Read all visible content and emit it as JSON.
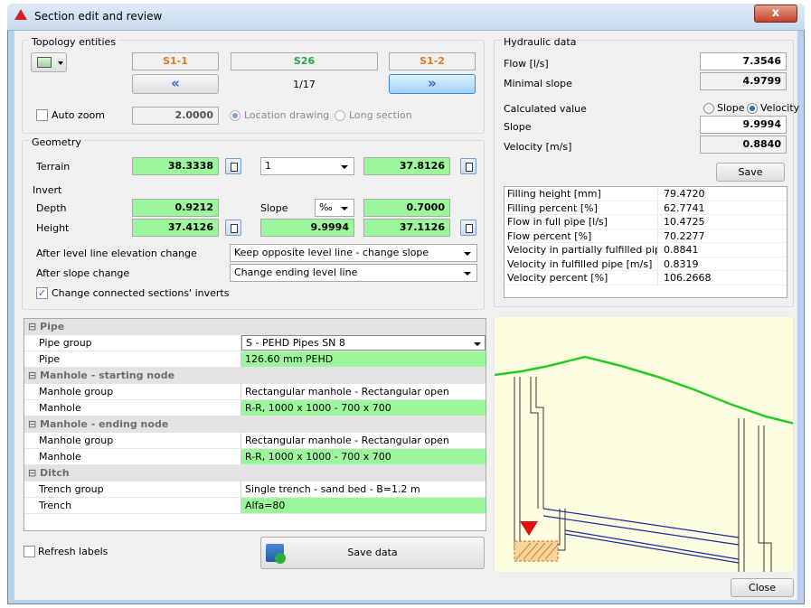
{
  "window": {
    "title": "Section edit and review",
    "close": "x"
  },
  "topology": {
    "group_label": "Topology entities",
    "start": "S1-1",
    "current": "S26",
    "end": "S1-2",
    "counter": "1/17",
    "prev_symbol": "«",
    "next_symbol": "»",
    "auto_zoom_label": "Auto zoom",
    "zoom_value": "2.0000",
    "location_label": "Location drawing",
    "long_section_label": "Long section"
  },
  "geometry": {
    "group_label": "Geometry",
    "terrain_label": "Terrain",
    "terrain_start": "38.3338",
    "terrain_combo": "1",
    "terrain_end": "37.8126",
    "invert_label": "Invert",
    "depth_label": "Depth",
    "depth_value": "0.9212",
    "slope_label": "Slope",
    "slope_unit": "‰",
    "slope_end": "0.7000",
    "height_label": "Height",
    "height_start": "37.4126",
    "slope_value": "9.9994",
    "height_end": "37.1126",
    "after_level_label": "After level line elevation change",
    "after_level_value": "Keep opposite level line - change slope",
    "after_slope_label": "After slope change",
    "after_slope_value": "Change ending level line",
    "change_connected_label": "Change connected sections' inverts"
  },
  "hydraulic": {
    "group_label": "Hydraulic data",
    "flow_label": "Flow [l/s]",
    "flow_value": "7.3546",
    "min_slope_label": "Minimal slope",
    "min_slope_value": "4.9799",
    "calc_label": "Calculated value",
    "radio_slope": "Slope",
    "radio_velocity": "Velocity",
    "slope_label": "Slope",
    "slope_value": "9.9994",
    "velocity_label": "Velocity [m/s]",
    "velocity_value": "0.8840",
    "save_label": "Save",
    "table": [
      {
        "k": "Filling height [mm]",
        "v": "79.4720"
      },
      {
        "k": "Filling  percent [%]",
        "v": "62.7741"
      },
      {
        "k": "Flow in full pipe [l/s]",
        "v": "10.4725"
      },
      {
        "k": "Flow percent [%]",
        "v": "70.2277"
      },
      {
        "k": "Velocity in partially fulfilled pipe [...",
        "v": "0.8841"
      },
      {
        "k": "Velocity in fulfilled pipe [m/s]",
        "v": "0.8319"
      },
      {
        "k": "Velocity percent [%]",
        "v": "106.2668"
      }
    ]
  },
  "props": {
    "pipe_section": "Pipe",
    "pipe_group_label": "Pipe group",
    "pipe_group_value": "S - PEHD Pipes SN 8",
    "pipe_label": "Pipe",
    "pipe_value": "126.60 mm PEHD",
    "ms_section": "Manhole - starting node",
    "ms_group_label": "Manhole group",
    "ms_group_value": "Rectangular manhole - Rectangular open",
    "ms_label": "Manhole",
    "ms_value": "R-R, 1000 x 1000 - 700 x 700",
    "me_section": "Manhole - ending node",
    "me_group_label": "Manhole group",
    "me_group_value": "Rectangular manhole - Rectangular open",
    "me_label": "Manhole",
    "me_value": "R-R, 1000 x 1000 - 700 x 700",
    "ditch_section": "Ditch",
    "trench_group_label": "Trench group",
    "trench_group_value": "Single trench - sand bed - B=1.2 m",
    "trench_label": "Trench",
    "trench_value": "Alfa=80"
  },
  "bottom": {
    "refresh_label": "Refresh labels",
    "save_data_label": "Save data",
    "close_label": "Close"
  },
  "colors": {
    "green_field": "#9cf79c",
    "preview_bg": "#fffde0",
    "terrain_line": "#22cc22",
    "pipe_line": "#1a2a9a"
  }
}
